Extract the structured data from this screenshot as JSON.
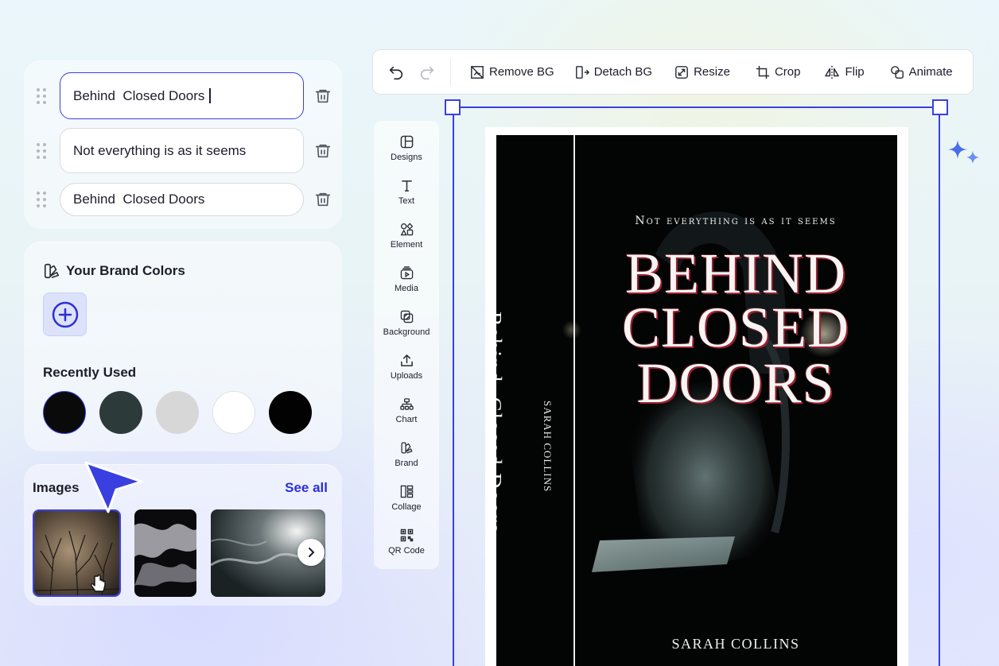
{
  "text_rows": [
    {
      "value": "Behind  Closed Doors",
      "active": true
    },
    {
      "value": "Not everything is as it seems",
      "active": false
    },
    {
      "value": "Behind  Closed Doors",
      "active": false
    }
  ],
  "brand": {
    "title": "Your Brand Colors",
    "recent_title": "Recently Used",
    "recent_colors": [
      "#0a0a0a",
      "#2d3a3a",
      "#d7d7d7",
      "#ffffff",
      "#020202"
    ]
  },
  "images": {
    "title": "Images",
    "see_all": "See all"
  },
  "toolbar": {
    "remove_bg": "Remove BG",
    "detach_bg": "Detach BG",
    "resize": "Resize",
    "crop": "Crop",
    "flip": "Flip",
    "animate": "Animate"
  },
  "tools": [
    {
      "label": "Designs",
      "icon": "layout-icon"
    },
    {
      "label": "Text",
      "icon": "text-icon"
    },
    {
      "label": "Element",
      "icon": "shapes-icon"
    },
    {
      "label": "Media",
      "icon": "media-icon"
    },
    {
      "label": "Background",
      "icon": "background-icon"
    },
    {
      "label": "Uploads",
      "icon": "upload-icon"
    },
    {
      "label": "Chart",
      "icon": "chart-icon"
    },
    {
      "label": "Brand",
      "icon": "brand-icon"
    },
    {
      "label": "Collage",
      "icon": "collage-icon"
    },
    {
      "label": "QR Code",
      "icon": "qr-code-icon"
    }
  ],
  "cover": {
    "subtitle": "Not everything is as it seems",
    "title_lines": [
      "BEHIND",
      "CLOSED",
      "DOORS"
    ],
    "author": "SARAH COLLINS",
    "spine_title": "Behind  Closed Doors",
    "spine_author": "SARAH COLLINS"
  },
  "colors": {
    "accent": "#3a3fe0",
    "link": "#2b2fd6"
  }
}
